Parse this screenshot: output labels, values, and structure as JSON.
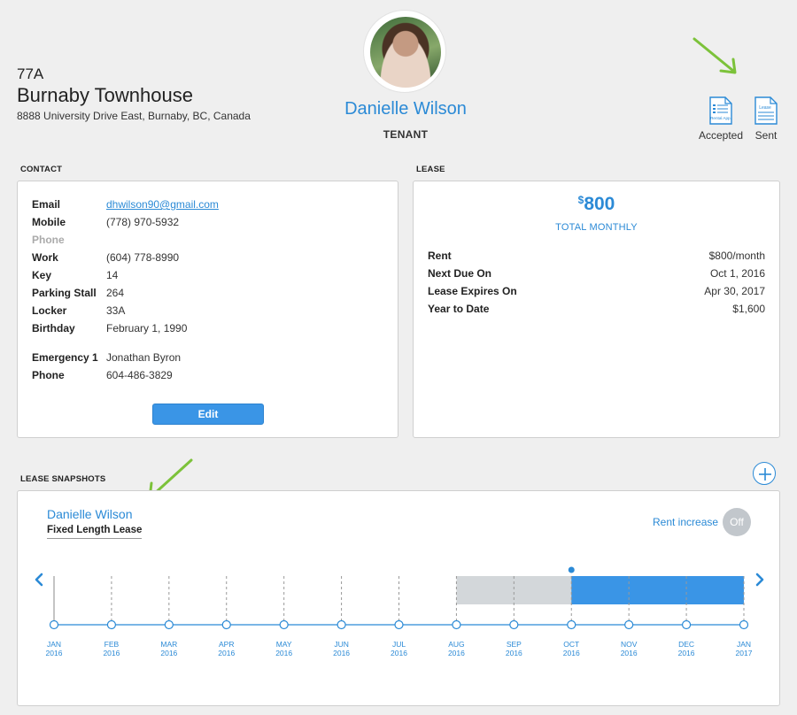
{
  "property": {
    "unit": "77A",
    "name": "Burnaby Townhouse",
    "address": "8888 University Drive East, Burnaby, BC, Canada"
  },
  "tenant": {
    "name": "Danielle Wilson",
    "role": "TENANT"
  },
  "documents": [
    {
      "icon": "rental-app-icon",
      "icon_text": "Rental App.",
      "label": "Accepted"
    },
    {
      "icon": "lease-doc-icon",
      "icon_text": "Lease",
      "label": "Sent"
    }
  ],
  "contact": {
    "section_label": "CONTACT",
    "rows": [
      {
        "key": "Email",
        "value": "dhwilson90@gmail.com"
      },
      {
        "key": "Mobile",
        "value": "(778) 970-5932"
      },
      {
        "key": "Phone",
        "value": ""
      },
      {
        "key": "Work",
        "value": "(604) 778-8990"
      },
      {
        "key": "Key",
        "value": "14"
      },
      {
        "key": "Parking Stall",
        "value": "264"
      },
      {
        "key": "Locker",
        "value": "33A"
      },
      {
        "key": "Birthday",
        "value": "February 1, 1990"
      },
      {
        "key": "Emergency 1",
        "value": "Jonathan Byron"
      },
      {
        "key": "Phone",
        "value": "604-486-3829"
      }
    ],
    "edit_label": "Edit"
  },
  "lease": {
    "section_label": "LEASE",
    "currency": "$",
    "amount": "800",
    "total_label": "TOTAL MONTHLY",
    "rows": [
      {
        "key": "Rent",
        "value": "$800/month"
      },
      {
        "key": "Next Due On",
        "value": "Oct 1, 2016"
      },
      {
        "key": "Lease Expires On",
        "value": "Apr 30, 2017"
      },
      {
        "key": "Year to Date",
        "value": "$1,600"
      }
    ]
  },
  "snapshots": {
    "section_label": "LEASE SNAPSHOTS",
    "tenant_name": "Danielle Wilson",
    "lease_type": "Fixed Length Lease",
    "rent_increase_label": "Rent increase",
    "toggle_label": "Off",
    "months": [
      {
        "m": "JAN",
        "y": "2016"
      },
      {
        "m": "FEB",
        "y": "2016"
      },
      {
        "m": "MAR",
        "y": "2016"
      },
      {
        "m": "APR",
        "y": "2016"
      },
      {
        "m": "MAY",
        "y": "2016"
      },
      {
        "m": "JUN",
        "y": "2016"
      },
      {
        "m": "JUL",
        "y": "2016"
      },
      {
        "m": "AUG",
        "y": "2016"
      },
      {
        "m": "SEP",
        "y": "2016"
      },
      {
        "m": "OCT",
        "y": "2016"
      },
      {
        "m": "NOV",
        "y": "2016"
      },
      {
        "m": "DEC",
        "y": "2016"
      },
      {
        "m": "JAN",
        "y": "2017"
      }
    ],
    "past_segment_months": [
      7,
      9
    ],
    "future_segment_months": [
      9,
      12
    ],
    "today_month_index": 9
  },
  "colors": {
    "accent": "#2b8ad6",
    "button": "#3a95e6",
    "past_segment": "#d3d7da",
    "future_segment": "#3a95e6",
    "arrow": "#7cc23a"
  }
}
